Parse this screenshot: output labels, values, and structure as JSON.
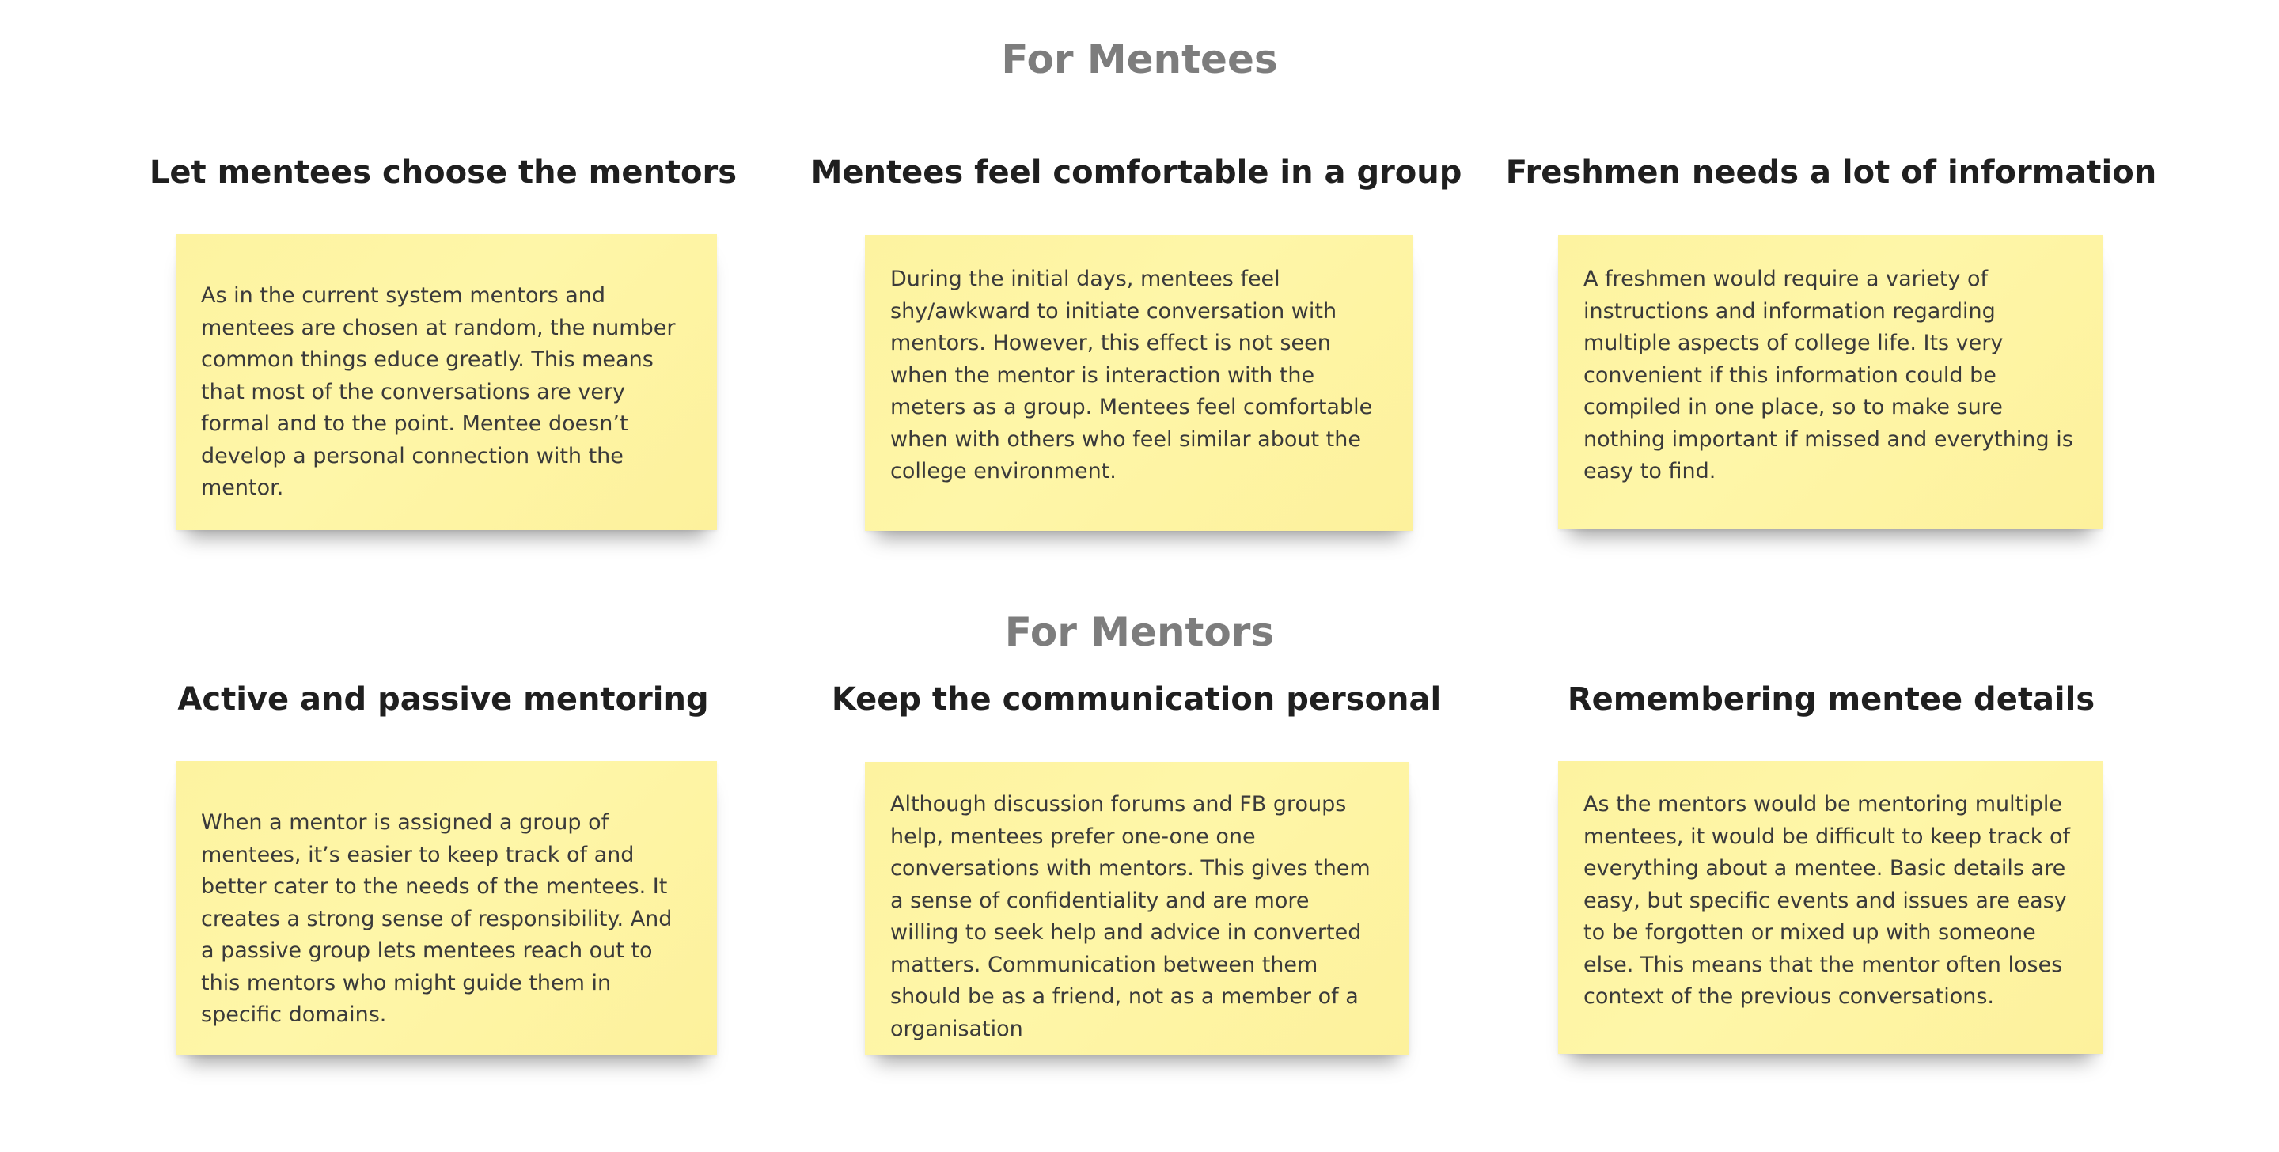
{
  "sections": {
    "mentees": {
      "title": "For Mentees",
      "cards": [
        {
          "heading": "Let mentees choose the mentors",
          "body": "As in the current system mentors and mentees are chosen at random, the number common things educe greatly. This means that most of the conversations are very formal and to the point. Mentee doesn’t develop a personal connection with the mentor."
        },
        {
          "heading": "Mentees feel comfortable in a group",
          "body": "During the initial days, mentees feel shy/awkward to initiate conversation with mentors. However, this effect is not seen when the mentor is interaction with the meters as a group. Mentees feel comfortable when with others who feel similar about the college environment."
        },
        {
          "heading": "Freshmen needs a lot of information",
          "body": "A freshmen would require a variety of instructions and information regarding multiple aspects of college life. Its very convenient if this information could be compiled in one place, so to make sure nothing important if missed and everything is easy to find."
        }
      ]
    },
    "mentors": {
      "title": "For Mentors",
      "cards": [
        {
          "heading": "Active and passive mentoring",
          "body": "When a mentor is assigned a group of mentees, it’s easier to keep track of and better cater to the needs of the mentees. It creates a strong sense of responsibility. And a passive group lets mentees reach out to this mentors who might guide them in specific domains."
        },
        {
          "heading": "Keep the communication personal",
          "body": "Although discussion forums and FB groups help, mentees prefer one-one one conversations with mentors. This gives them a sense of confidentiality and are more willing to seek help and advice in converted matters. Communication between them should be as a friend, not as a member of a organisation"
        },
        {
          "heading": "Remembering mentee details",
          "body": "As the mentors would be mentoring multiple mentees, it would be difficult to keep track of everything about a mentee. Basic details are easy, but specific events and issues are easy to be forgotten or mixed up with someone else. This means that the mentor often loses context of the previous conversations."
        }
      ]
    }
  },
  "colors": {
    "note_background": "#fef6a8",
    "section_title": "#7d7d7d",
    "heading": "#1f1f1f",
    "body_text": "#3a3a3a"
  }
}
